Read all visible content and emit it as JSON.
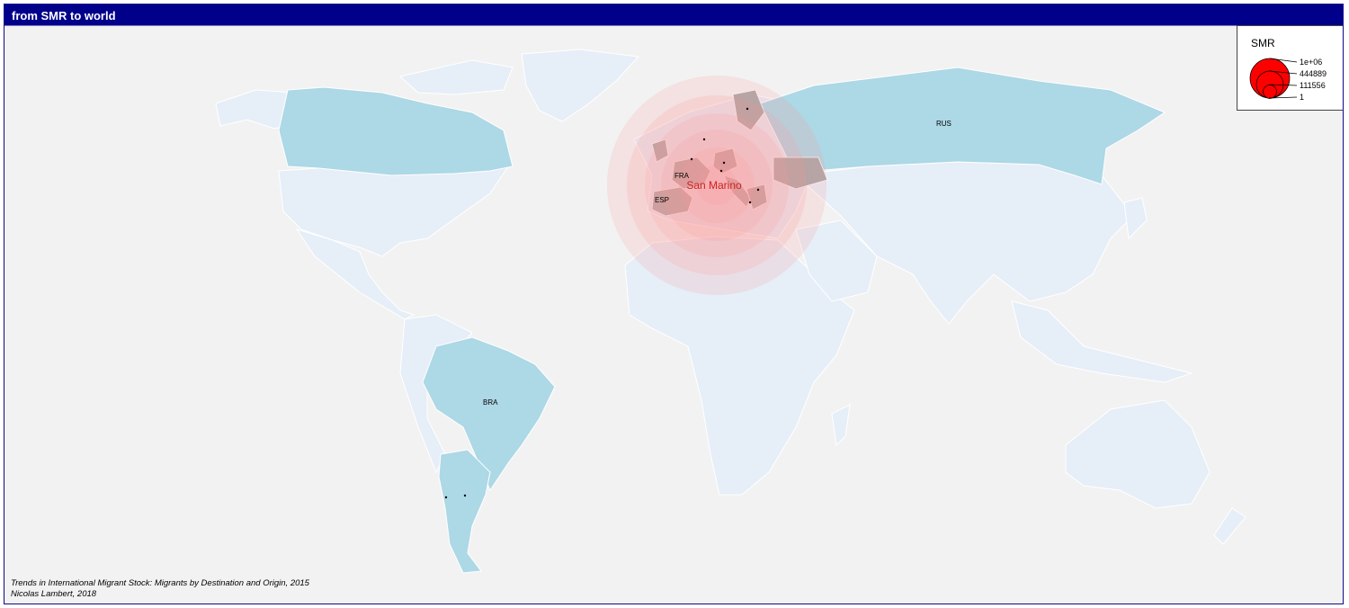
{
  "title": "from SMR to world",
  "origin": {
    "code": "SMR",
    "name": "San Marino"
  },
  "legend": {
    "title": "SMR",
    "values": [
      "1e+06",
      "444889",
      "111556",
      "1"
    ],
    "circle_color": "#ff0000"
  },
  "country_labels": [
    "RUS",
    "FRA",
    "ESP",
    "BRA"
  ],
  "source_lines": [
    "Trends in International Migrant Stock: Migrants by Destination and Origin, 2015",
    "Nicolas Lambert, 2018"
  ],
  "colors": {
    "background": "#f2f2f2",
    "land": "#e6eef8",
    "destination_countries": "#add8e6",
    "neighbor_countries": "#a8a8a8",
    "origin_label": "#cc2222",
    "title_bar": "#00008b"
  }
}
